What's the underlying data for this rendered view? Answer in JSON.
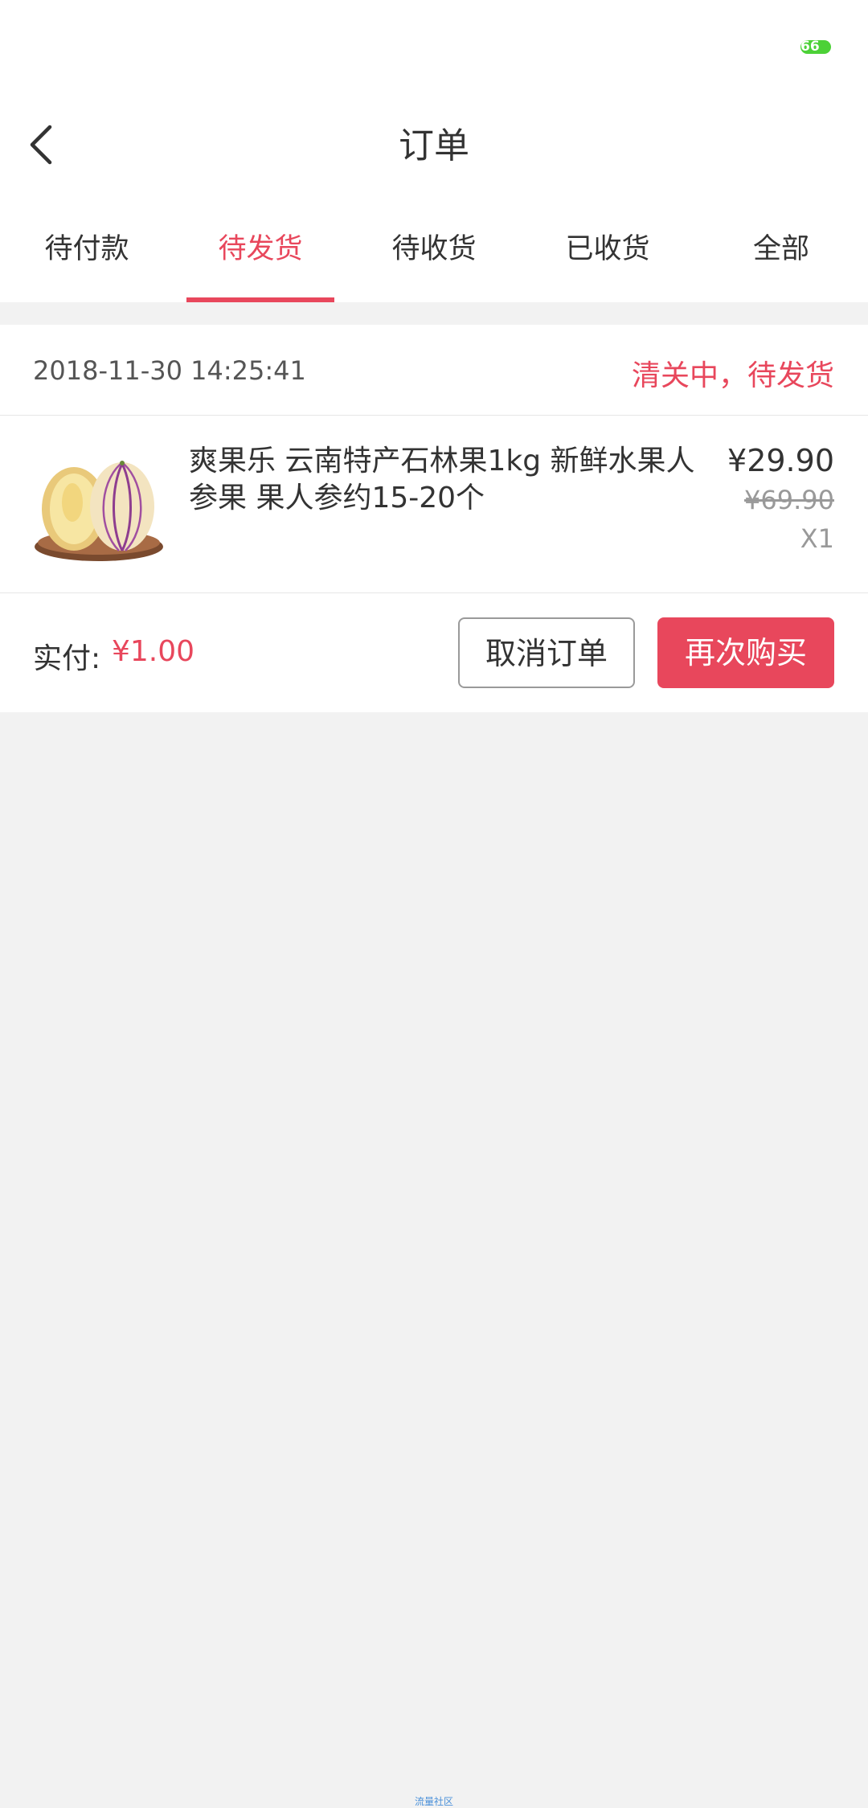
{
  "status_bar": {
    "battery_level": "66"
  },
  "header": {
    "title": "订单"
  },
  "tabs": [
    {
      "label": "待付款",
      "active": false
    },
    {
      "label": "待发货",
      "active": true
    },
    {
      "label": "待收货",
      "active": false
    },
    {
      "label": "已收货",
      "active": false
    },
    {
      "label": "全部",
      "active": false
    }
  ],
  "order": {
    "time": "2018-11-30 14:25:41",
    "status": "清关中，待发货",
    "product": {
      "name": "爽果乐 云南特产石林果1kg 新鲜水果人参果 果人参约15-20个",
      "price": "¥29.90",
      "original_price": "¥69.90",
      "quantity": "X1"
    },
    "paid_label": "实付:",
    "paid_amount": "¥1.00",
    "cancel_label": "取消订单",
    "rebuy_label": "再次购买"
  },
  "watermark": "流量社区",
  "colors": {
    "accent": "#e8475c",
    "battery": "#4cd137",
    "background": "#f2f2f2"
  }
}
